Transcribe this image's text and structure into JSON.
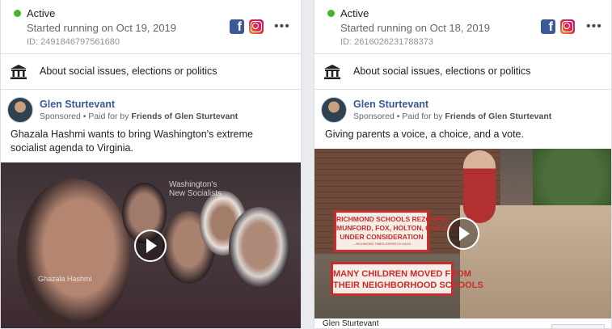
{
  "colors": {
    "active": "#42b72a",
    "advertiser": "#385898",
    "ad_red": "#c72d2d"
  },
  "icons": {
    "platform_facebook": "facebook-icon",
    "platform_instagram": "instagram-icon",
    "topic": "bank-building-icon",
    "more": "more-options-icon"
  },
  "ads": [
    {
      "status": "Active",
      "started": "Started running on Oct 19, 2019",
      "id": "ID: 2491846797561680",
      "topic": "About social issues, elections or politics",
      "advertiser": "Glen Sturtevant",
      "sponsored": "Sponsored",
      "paid_for_prefix": " • Paid for by ",
      "paid_for": "Friends of Glen Sturtevant",
      "body": "Ghazala Hashmi wants to bring Washington's extreme socialist agenda to Virginia.",
      "video": {
        "overlay_title": "Washington's\nNew Socialists",
        "caption": "Ghazala Hashmi"
      }
    },
    {
      "status": "Active",
      "started": "Started running on Oct 18, 2019",
      "id": "ID: 2616026231788373",
      "topic": "About social issues, elections or politics",
      "advertiser": "Glen Sturtevant",
      "sponsored": "Sponsored",
      "paid_for_prefix": " • Paid for by ",
      "paid_for": "Friends of Glen Sturtevant",
      "body": "Giving parents a voice, a choice, and a vote.",
      "video": {
        "headline": "RICHMOND SCHOOLS REZONING:\nMUNFORD, FOX, HOLTON, CARVER\nUNDER CONSIDERATION",
        "headline_source": "—RICHMOND TIMES-DISPATCH 10/15",
        "subhead": "MANY CHILDREN MOVED FROM\nTHEIR NEIGHBORHOOD SCHOOLS"
      },
      "footer_name": "Glen Sturtevant"
    }
  ]
}
